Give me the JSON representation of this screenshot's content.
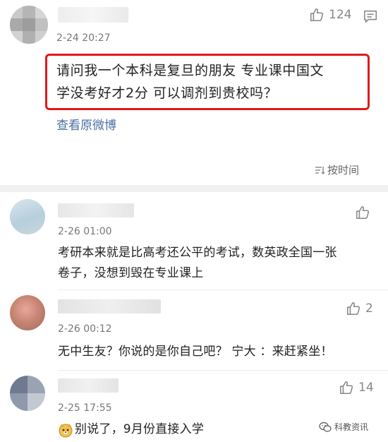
{
  "top_comment": {
    "time": "2-24 20:27",
    "like_count": "124",
    "text_line1": "请问我一个本科是复旦的朋友 专业课中国文",
    "text_line2": "学没考好才2分 可以调剂到贵校吗？",
    "link": "查看原微博",
    "highlight_color": "#e0191e"
  },
  "sort": {
    "label": "按时间"
  },
  "replies": [
    {
      "time": "2-26 01:00",
      "like_count": "",
      "line1": "考研本来就是比高考还公平的考试，数英政全国一张",
      "line2": "卷子，没想到毁在专业课上"
    },
    {
      "time": "2-26 00:12",
      "like_count": "2",
      "line1": "无中生友？你说的是你自己吧？ 宁大 ：来赶紧坐！"
    },
    {
      "time": "2-25 17:55",
      "like_count": "14",
      "line1": "别说了，9月份直接入学"
    }
  ],
  "watermark": {
    "text": "科教资讯"
  },
  "colors": {
    "link": "#4a6fa5",
    "icon_gray": "#888888"
  }
}
